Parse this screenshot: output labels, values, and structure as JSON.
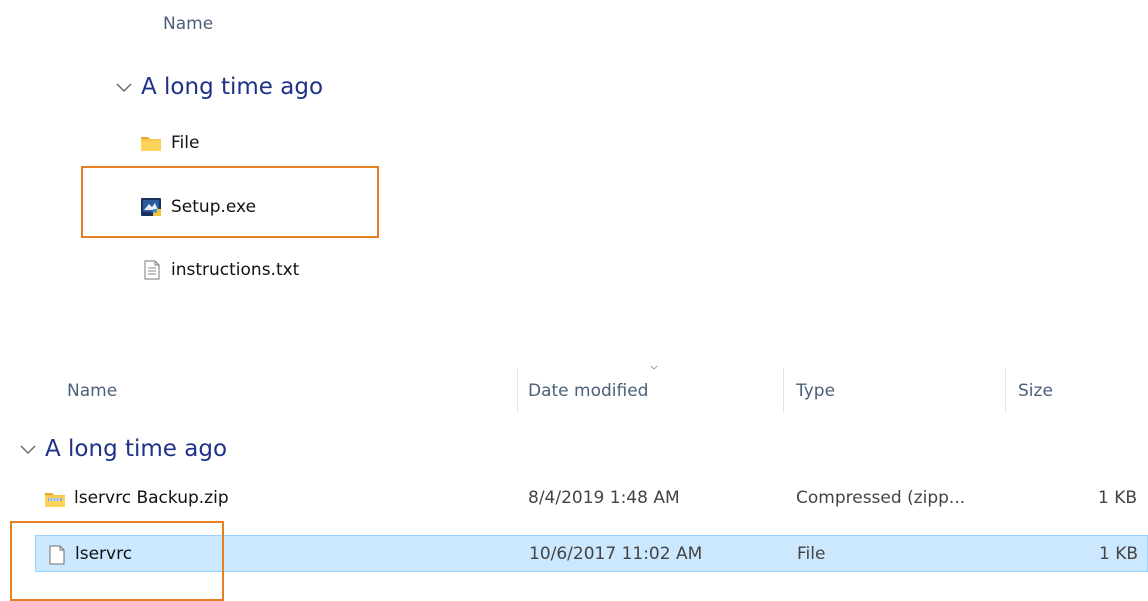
{
  "top_view": {
    "column_header": "Name",
    "group_title": "A long time ago",
    "items": [
      {
        "name": "File",
        "icon": "folder-icon"
      },
      {
        "name": "Setup.exe",
        "icon": "installer-app-icon"
      },
      {
        "name": "instructions.txt",
        "icon": "text-document-icon"
      }
    ]
  },
  "bottom_view": {
    "columns": {
      "name": "Name",
      "date_modified": "Date modified",
      "type": "Type",
      "size": "Size"
    },
    "group_title": "A long time ago",
    "rows": [
      {
        "name": "lservrc Backup.zip",
        "date_modified": "8/4/2019 1:48 AM",
        "type": "Compressed (zipp...",
        "size": "1 KB",
        "icon": "zip-folder-icon",
        "selected": false
      },
      {
        "name": "lservrc",
        "date_modified": "10/6/2017 11:02 AM",
        "type": "File",
        "size": "1 KB",
        "icon": "blank-file-icon",
        "selected": true
      }
    ]
  },
  "colors": {
    "group_title": "#1e3287",
    "highlight_box": "#e67e22",
    "selection_bg": "#cce8ff",
    "selection_border": "#99d1ff"
  }
}
